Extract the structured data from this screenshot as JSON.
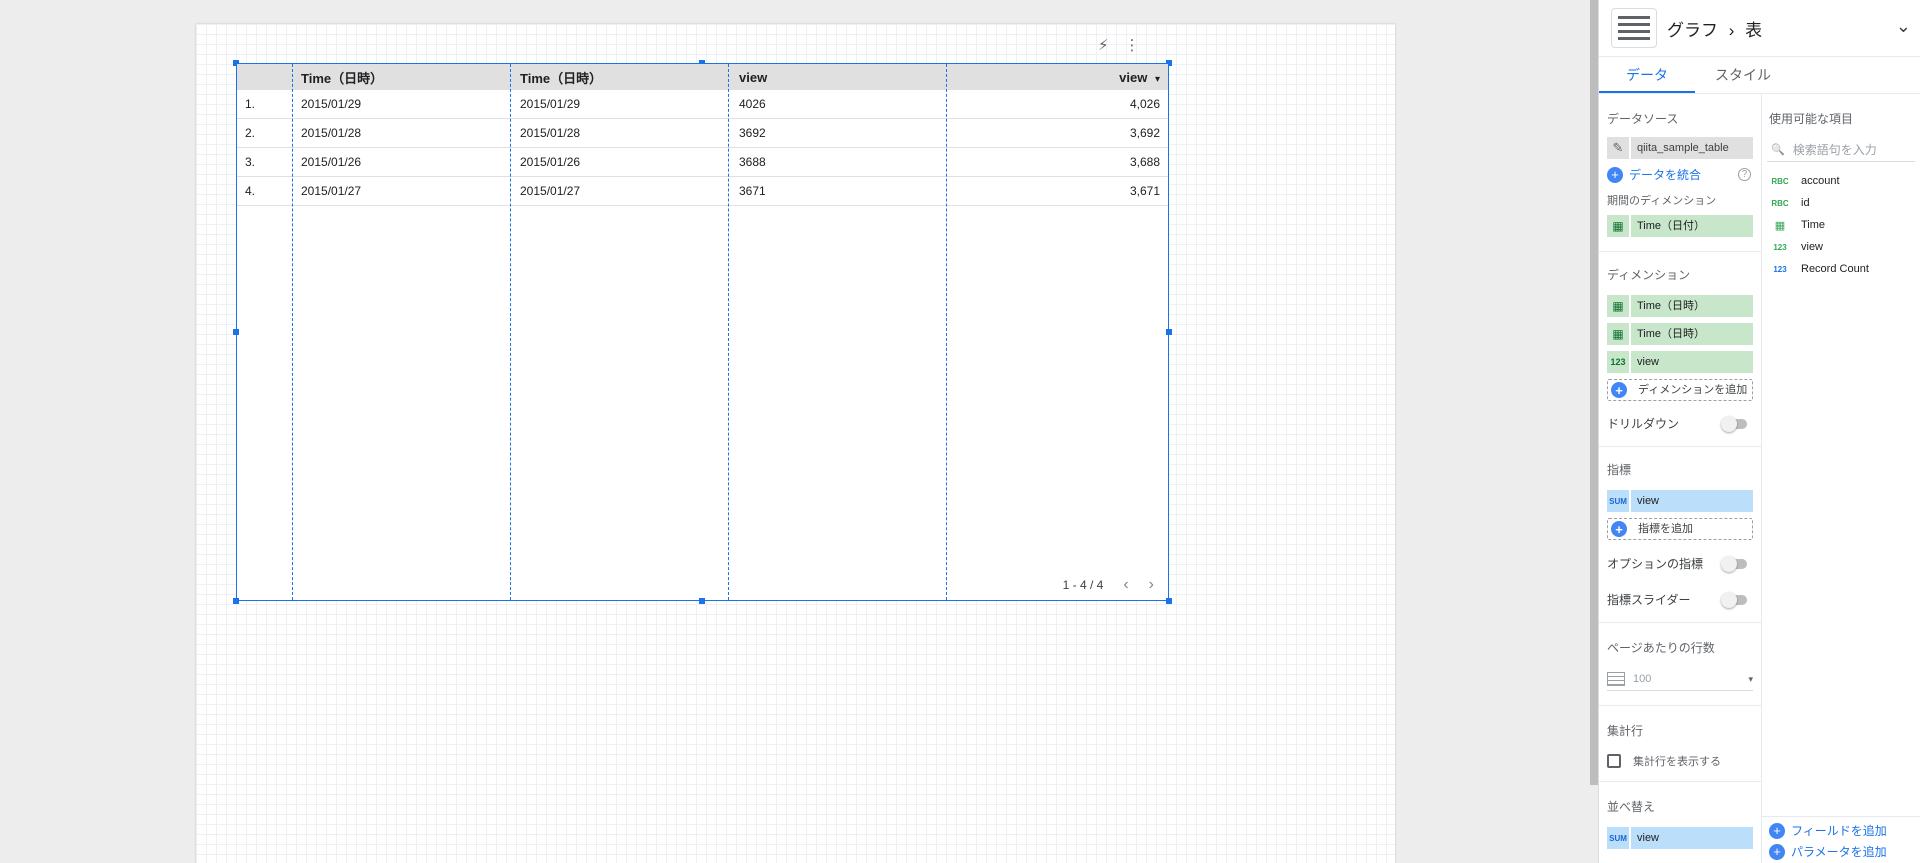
{
  "canvas": {
    "toolbar": {
      "bolt_icon": "⚡",
      "more_icon": "⋮"
    },
    "table": {
      "headers": [
        "Time（日時）",
        "Time（日時）",
        "view",
        "view"
      ],
      "sort_indicator": "▾",
      "rows": [
        {
          "idx": "1.",
          "a": "2015/01/29",
          "b": "2015/01/29",
          "c": "4026",
          "d": "4,026"
        },
        {
          "idx": "2.",
          "a": "2015/01/28",
          "b": "2015/01/28",
          "c": "3692",
          "d": "3,692"
        },
        {
          "idx": "3.",
          "a": "2015/01/26",
          "b": "2015/01/26",
          "c": "3688",
          "d": "3,688"
        },
        {
          "idx": "4.",
          "a": "2015/01/27",
          "b": "2015/01/27",
          "c": "3671",
          "d": "3,671"
        }
      ],
      "pagination": {
        "label": "1 - 4 / 4",
        "prev": "‹",
        "next": "›"
      }
    }
  },
  "panel": {
    "breadcrumb": {
      "parent": "グラフ",
      "separator": "›",
      "current": "表"
    },
    "collapse_icon": "⌄",
    "tabs": [
      {
        "label": "データ",
        "active": true
      },
      {
        "label": "スタイル",
        "active": false
      }
    ],
    "data_source": {
      "title": "データソース",
      "name": "qiita_sample_table",
      "edit_icon": "✎",
      "blend_label": "データを統合",
      "help_icon": "?"
    },
    "date_range_dimension": {
      "title": "期間のディメンション",
      "chip": {
        "type": "calendar",
        "icon": "▦",
        "label": "Time（日付）"
      }
    },
    "dimensions": {
      "title": "ディメンション",
      "chips": [
        {
          "icon": "▦",
          "label": "Time（日時）"
        },
        {
          "icon": "▦",
          "label": "Time（日時）"
        },
        {
          "icon": "123",
          "label": "view"
        }
      ],
      "add_label": "ディメンションを追加"
    },
    "drilldown": {
      "label": "ドリルダウン",
      "on": false
    },
    "metrics": {
      "title": "指標",
      "chips": [
        {
          "icon": "SUM",
          "label": "view"
        }
      ],
      "add_label": "指標を追加"
    },
    "optional_metrics": {
      "label": "オプションの指標",
      "on": false
    },
    "metric_slider": {
      "label": "指標スライダー",
      "on": false
    },
    "rows_per_page": {
      "title": "ページあたりの行数",
      "value": "100",
      "caret": "▾"
    },
    "summary_row": {
      "title": "集計行",
      "checkbox_label": "集計行を表示する",
      "checked": false
    },
    "sort": {
      "title": "並べ替え",
      "chip": {
        "icon": "SUM",
        "label": "view"
      }
    },
    "available_fields": {
      "title": "使用可能な項目",
      "search_placeholder": "検索語句を入力",
      "search_icon": "🔍",
      "fields": [
        {
          "type": "RBC",
          "type_color": "#34a853",
          "name": "account"
        },
        {
          "type": "RBC",
          "type_color": "#34a853",
          "name": "id"
        },
        {
          "type": "▦",
          "type_color": "#34a853",
          "name": "Time"
        },
        {
          "type": "123",
          "type_color": "#34a853",
          "name": "view"
        },
        {
          "type": "123",
          "type_color": "#1a73e8",
          "name": "Record Count"
        }
      ],
      "add_field_label": "フィールドを追加",
      "add_param_label": "パラメータを追加"
    }
  }
}
